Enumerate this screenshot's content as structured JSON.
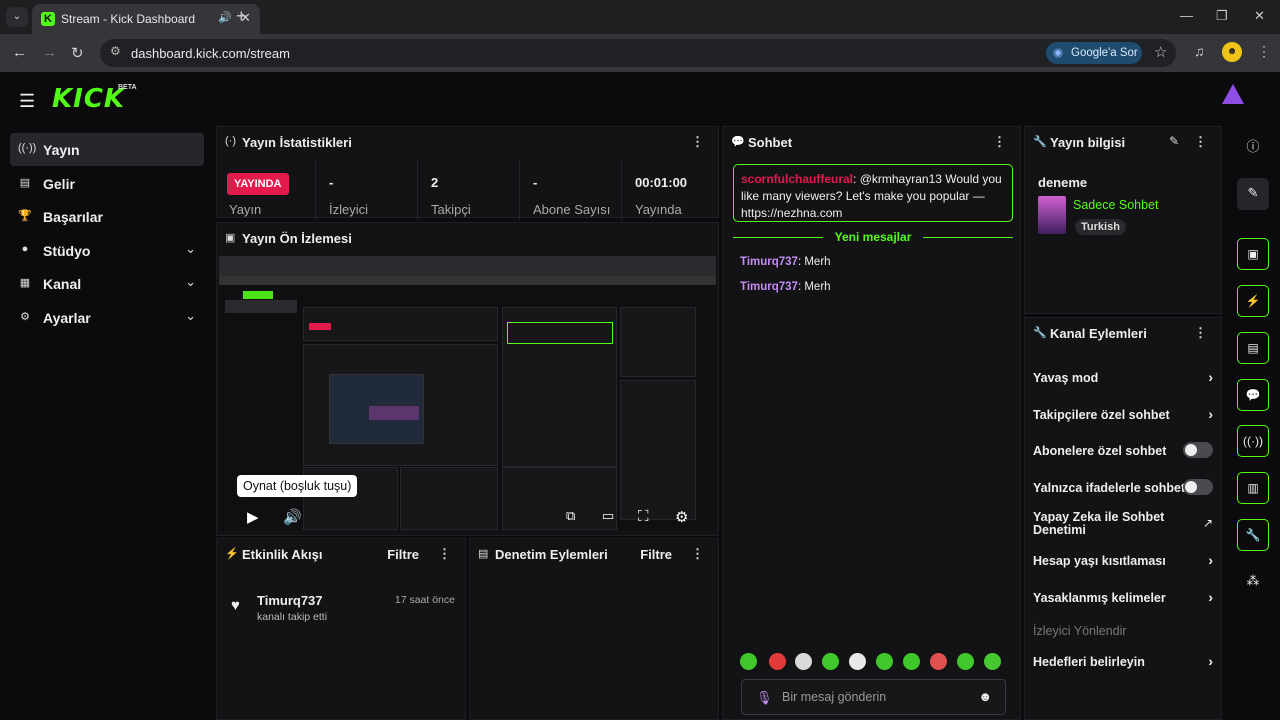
{
  "browser": {
    "tab_title": "Stream - Kick Dashboard",
    "url": "dashboard.kick.com/stream",
    "google_btn": "Google'a Sor"
  },
  "app": {
    "logo": "KICK",
    "logo_badge": "BETA",
    "nav": [
      {
        "label": "Yayın",
        "icon": "broadcast-icon"
      },
      {
        "label": "Gelir",
        "icon": "revenue-icon"
      },
      {
        "label": "Başarılar",
        "icon": "trophy-icon"
      },
      {
        "label": "Stüdyo",
        "icon": "studio-icon"
      },
      {
        "label": "Kanal",
        "icon": "channel-icon"
      },
      {
        "label": "Ayarlar",
        "icon": "settings-icon"
      }
    ]
  },
  "stats_panel": {
    "title": "Yayın İstatistikleri",
    "live_badge": "YAYINDA",
    "items": [
      {
        "value": "",
        "label": "Yayın"
      },
      {
        "value": "-",
        "label": "İzleyici"
      },
      {
        "value": "2",
        "label": "Takipçi"
      },
      {
        "value": "-",
        "label": "Abone Sayısı"
      },
      {
        "value": "00:01:00",
        "label": "Yayında"
      }
    ]
  },
  "preview_panel": {
    "title": "Yayın Ön İzlemesi",
    "tooltip": "Oynat (boşluk tuşu)"
  },
  "activity_panel": {
    "title": "Etkinlik Akışı",
    "filter": "Filtre",
    "items": [
      {
        "user": "Timurq737",
        "text": "kanalı takip etti",
        "time": "17 saat önce"
      }
    ]
  },
  "moderation_panel": {
    "title": "Denetim Eylemleri",
    "filter": "Filtre"
  },
  "chat_panel": {
    "title": "Sohbet",
    "pinned_user": "scornfulchauffeural",
    "pinned_text": ": @krmhayran13 Would you like many viewers? Let's make you popular — https://nezhna.com",
    "new_messages": "Yeni mesajlar",
    "messages": [
      {
        "user": "Timurq737",
        "text": ": Merh"
      },
      {
        "user": "Timurq737",
        "text": ": Merh"
      }
    ],
    "input_placeholder": "Bir mesaj gönderin"
  },
  "stream_info": {
    "title": "Yayın bilgisi",
    "stream_title": "deneme",
    "category": "Sadece Sohbet",
    "tag": "Turkish"
  },
  "channel_actions": {
    "title": "Kanal Eylemleri",
    "items": [
      {
        "label": "Yavaş mod",
        "kind": "arrow"
      },
      {
        "label": "Takipçilere özel sohbet",
        "kind": "arrow"
      },
      {
        "label": "Abonelere özel sohbet",
        "kind": "toggle",
        "on": false
      },
      {
        "label": "Yalnızca ifadelerle sohbet",
        "kind": "toggle",
        "on": false
      },
      {
        "label": "Yapay Zeka ile Sohbet Denetimi",
        "kind": "external"
      },
      {
        "label": "Hesap yaşı kısıtlaması",
        "kind": "arrow"
      },
      {
        "label": "Yasaklanmış kelimeler",
        "kind": "arrow"
      },
      {
        "label": "İzleyici Yönlendir",
        "kind": "disabled"
      },
      {
        "label": "Hedefleri belirleyin",
        "kind": "arrow"
      }
    ]
  },
  "rail": [
    "info-icon",
    "edit-icon",
    "preview-icon",
    "activity-icon",
    "moderation-icon",
    "chat-icon",
    "broadcast-icon",
    "layout-icon",
    "tools-icon",
    "integrations-icon"
  ],
  "colors": {
    "accent": "#53fc18",
    "live": "#e31b4c",
    "username": "#c58cf2"
  }
}
